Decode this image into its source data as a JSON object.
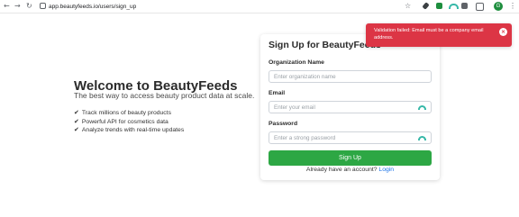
{
  "browser": {
    "url": "app.beautyfeeds.io/users/sign_up",
    "back_icon": "←",
    "forward_icon": "→",
    "reload_icon": "↻",
    "star_icon": "☆",
    "profile_initial": "G",
    "menu_icon": "⋮"
  },
  "hero": {
    "title": "Welcome to BeautyFeeds",
    "subtitle": "The best way to access beauty product data at scale.",
    "check_glyph": "✔",
    "features": [
      "Track millions of beauty products",
      "Powerful API for cosmetics data",
      "Analyze trends with real-time updates"
    ]
  },
  "form": {
    "title": "Sign Up for BeautyFeeds",
    "org_label": "Organization Name",
    "org_placeholder": "Enter organization name",
    "org_value": "",
    "email_label": "Email",
    "email_placeholder": "Enter your email",
    "email_value": "",
    "password_label": "Password",
    "password_placeholder": "Enter a strong password",
    "password_value": "",
    "submit_label": "Sign Up",
    "login_prompt": "Already have an account?",
    "login_link": "Login"
  },
  "toast": {
    "message": "Validation failed: Email must be a company email address.",
    "close_glyph": "×"
  },
  "colors": {
    "accent_green": "#2da744",
    "error_red": "#dc3545",
    "link_blue": "#1a73e8",
    "autofill_teal": "#36b8a8"
  }
}
